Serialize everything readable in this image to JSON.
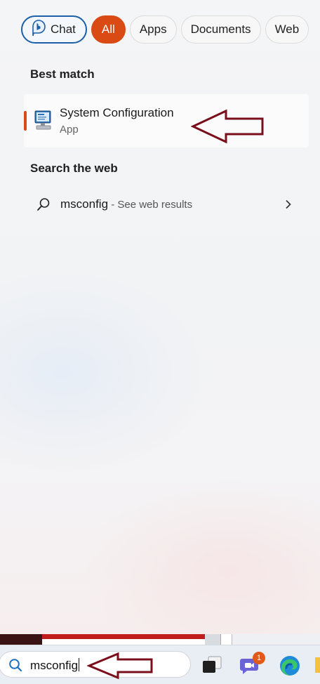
{
  "filters": {
    "chat_label": "Chat",
    "tabs": [
      {
        "label": "All",
        "active": true
      },
      {
        "label": "Apps",
        "active": false
      },
      {
        "label": "Documents",
        "active": false
      },
      {
        "label": "Web",
        "active": false
      }
    ]
  },
  "best_match": {
    "heading": "Best match",
    "name": "System Configuration",
    "kind": "App",
    "icon": "system-configuration-icon"
  },
  "web_search": {
    "heading": "Search the web",
    "query": "msconfig",
    "suffix": " - See web results"
  },
  "taskbar": {
    "search_value": "msconfig",
    "teams_badge": "1"
  },
  "colors": {
    "accent": "#d94a14",
    "chat_border": "#1d5fa8",
    "annotation_arrow": "#7a0f1c"
  }
}
